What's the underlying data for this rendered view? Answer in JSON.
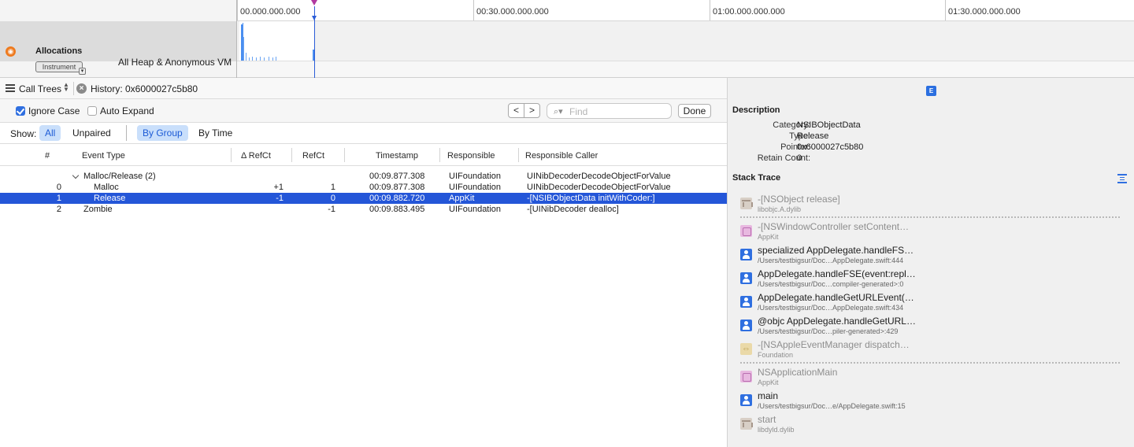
{
  "timeline": {
    "ticks": [
      "00.000.000.000",
      "00:30.000.000.000",
      "01:00.000.000.000",
      "01:30.000.000.000"
    ],
    "instrument": {
      "name": "Allocations",
      "badge": "Instrument",
      "detail": "All Heap & Anonymous VM"
    }
  },
  "jumpbar": {
    "calltrees": "Call Trees",
    "history": "History: 0x6000027c5b80"
  },
  "options": {
    "ignore_case": "Ignore Case",
    "ignore_case_checked": true,
    "auto_expand": "Auto Expand",
    "auto_expand_checked": false,
    "prev": "<",
    "next": ">",
    "find_placeholder": "Find",
    "done": "Done"
  },
  "filter": {
    "show_label": "Show:",
    "all": "All",
    "unpaired": "Unpaired",
    "by_group": "By Group",
    "by_time": "By Time"
  },
  "table": {
    "headers": {
      "num": "#",
      "event_type": "Event Type",
      "delta_refct": "Δ RefCt",
      "refct": "RefCt",
      "timestamp": "Timestamp",
      "responsible": "Responsible",
      "caller": "Responsible Caller"
    },
    "rows": [
      {
        "num": "",
        "event_type": "Malloc/Release (2)",
        "delta": "",
        "refct": "",
        "timestamp": "00:09.877.308",
        "responsible": "UIFoundation",
        "caller": "UINibDecoderDecodeObjectForValue"
      },
      {
        "num": "0",
        "event_type": "Malloc",
        "delta": "+1",
        "refct": "1",
        "timestamp": "00:09.877.308",
        "responsible": "UIFoundation",
        "caller": "UINibDecoderDecodeObjectForValue"
      },
      {
        "num": "1",
        "event_type": "Release",
        "delta": "-1",
        "refct": "0",
        "timestamp": "00:09.882.720",
        "responsible": "AppKit",
        "caller": "-[NSIBObjectData initWithCoder:]"
      },
      {
        "num": "2",
        "event_type": "Zombie",
        "delta": "",
        "refct": "-1",
        "timestamp": "00:09.883.495",
        "responsible": "UIFoundation",
        "caller": "-[UINibDecoder dealloc]"
      }
    ]
  },
  "inspector": {
    "tab": "E",
    "description_title": "Description",
    "description": {
      "category_key": "Category:",
      "category": "NSIBObjectData",
      "type_key": "Type:",
      "type": "Release",
      "pointer_key": "Pointer:",
      "pointer": "0x6000027c5b80",
      "retain_key": "Retain Count:",
      "retain": "0"
    },
    "stack_title": "Stack Trace",
    "frames": [
      {
        "name": "-[NSObject release]",
        "sub": "libobjc.A.dylib",
        "icon": "library-icon"
      },
      {
        "name": "-[NSWindowController setContent…",
        "sub": "AppKit",
        "icon": "appkit-icon"
      },
      {
        "name": "specialized AppDelegate.handleFS…",
        "sub": "/Users/testbigsur/Doc…AppDelegate.swift:444",
        "icon": "user-code-icon"
      },
      {
        "name": "AppDelegate.handleFSE(event:repl…",
        "sub": "/Users/testbigsur/Doc…compiler-generated>:0",
        "icon": "user-code-icon"
      },
      {
        "name": "AppDelegate.handleGetURLEvent(…",
        "sub": "/Users/testbigsur/Doc…AppDelegate.swift:434",
        "icon": "user-code-icon"
      },
      {
        "name": "@objc AppDelegate.handleGetURL…",
        "sub": "/Users/testbigsur/Doc…piler-generated>:429",
        "icon": "user-code-icon"
      },
      {
        "name": "-[NSAppleEventManager dispatch…",
        "sub": "Foundation",
        "icon": "foundation-icon"
      },
      {
        "name": "NSApplicationMain",
        "sub": "AppKit",
        "icon": "appkit-icon"
      },
      {
        "name": "main",
        "sub": "/Users/testbigsur/Doc…e/AppDelegate.swift:15",
        "icon": "user-code-icon"
      },
      {
        "name": "start",
        "sub": "libdyld.dylib",
        "icon": "library-icon"
      }
    ]
  },
  "colors": {
    "selection": "#2456d8",
    "accent": "#2f6fe0",
    "instrument_icon": "#ee7a1e",
    "playhead": "#2b5dd8"
  }
}
